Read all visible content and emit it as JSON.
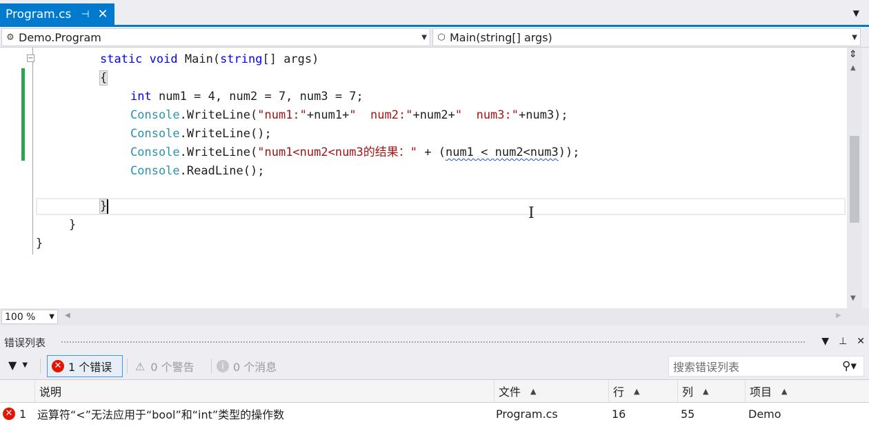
{
  "tab": {
    "title": "Program.cs",
    "pin_glyph": "⊣",
    "close_glyph": "✕",
    "menu_glyph": "▼"
  },
  "nav": {
    "class_scope": "Demo.Program",
    "member_scope": "Main(string[] args)"
  },
  "code": {
    "line_main": {
      "kw1": "static",
      "kw2": "void",
      "name": "Main(",
      "type": "string",
      "rest": "[] args)"
    },
    "open_brace": "{",
    "line_decl": {
      "kw": "int",
      "rest": " num1 = 4, num2 = 7, num3 = 7;"
    },
    "line_print1": {
      "cls": "Console",
      "call": ".WriteLine(",
      "s1": "\"num1:\"",
      "p1": "+num1+",
      "s2": "\"  num2:\"",
      "p2": "+num2+",
      "s3": "\"  num3:\"",
      "p3": "+num3);"
    },
    "line_print2": {
      "cls": "Console",
      "call": ".WriteLine();"
    },
    "line_print3": {
      "cls": "Console",
      "call": ".WriteLine(",
      "s1": "\"num1<num2<num3的结果：\"",
      "p1": " + (",
      "err": "num1 < num2<num3",
      "p2": "));"
    },
    "line_read": {
      "cls": "Console",
      "call": ".ReadLine();"
    },
    "close_method": "}",
    "close_class": "}",
    "close_ns": "}"
  },
  "zoom": {
    "level": "100 %"
  },
  "error_list": {
    "title": "错误列表",
    "errors_label": "1 个错误",
    "warnings_label": "0 个警告",
    "messages_label": "0 个消息",
    "search_placeholder": "搜索错误列表",
    "columns": {
      "description": "说明",
      "file": "文件",
      "line": "行",
      "column": "列",
      "project": "项目"
    },
    "rows": [
      {
        "index": "1",
        "description": "运算符“<”无法应用于“bool”和“int”类型的操作数",
        "file": "Program.cs",
        "line": "16",
        "column": "55",
        "project": "Demo"
      }
    ]
  },
  "colors": {
    "accent": "#007acc",
    "keyword": "#0000ff",
    "type": "#2b91af",
    "string": "#a31515",
    "error": "#e51400",
    "changebar": "#2fa44f"
  }
}
